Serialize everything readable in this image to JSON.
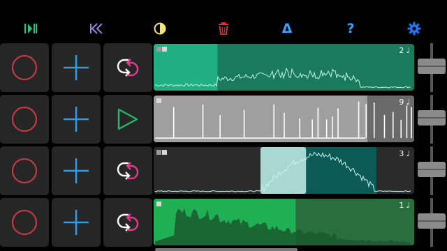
{
  "toolbar": {
    "buttons": [
      {
        "id": "play-pause",
        "icon": "play-pause-icon",
        "color": "#2ec27e"
      },
      {
        "id": "rewind",
        "icon": "rewind-icon",
        "color": "#9b7fe0"
      },
      {
        "id": "theme",
        "icon": "contrast-icon",
        "color": "#f5e27a"
      },
      {
        "id": "delete",
        "icon": "trash-icon",
        "color": "#e0303a"
      },
      {
        "id": "delta",
        "glyph": "Δ",
        "icon": "delta-icon",
        "color": "#3aa0ff"
      },
      {
        "id": "help",
        "glyph": "?",
        "icon": "help-icon",
        "color": "#3aa0ff"
      },
      {
        "id": "settings",
        "icon": "gear-icon",
        "color": "#1e78ff"
      }
    ]
  },
  "colors": {
    "record": "#c23a45",
    "add": "#2f9be8",
    "loop_arrow_white": "#ffffff",
    "loop_arrow_pink": "#e23a8f",
    "play": "#25b868",
    "control_bg": "#262626"
  },
  "tracks": [
    {
      "count_label": "2 ♩",
      "indicator": "double",
      "mode_icon": "loop-icon",
      "bg": "#1a7a5e",
      "active_fill": "#1faf82",
      "active_fraction": 0.245,
      "highlight": null,
      "wave_color": "#bff5e0",
      "wave_style": "line"
    },
    {
      "count_label": "9 ♩",
      "indicator": "single",
      "mode_icon": "play-icon",
      "bg": "#6a6a6a",
      "active_fill": "#9f9f9f",
      "active_fraction": 0.82,
      "highlight": null,
      "wave_color": "#ffffff",
      "wave_style": "spikes"
    },
    {
      "count_label": "3 ♩",
      "indicator": "double",
      "mode_icon": "loop-icon",
      "bg": "#2b2b2b",
      "active_fill": "#0c5a55",
      "active_fraction": null,
      "highlight": {
        "start": 0.41,
        "end": 0.585,
        "color": "#a9d7d2"
      },
      "region": {
        "start": 0.41,
        "end": 0.855
      },
      "wave_color": "#c8f2ef",
      "wave_style": "hump"
    },
    {
      "count_label": "1 ♩",
      "indicator": "single",
      "mode_icon": "loop-icon",
      "bg": "#2a6e3e",
      "active_fill": "#1fb054",
      "active_fraction": 0.545,
      "highlight": null,
      "wave_color": "#1a5a2e",
      "wave_style": "filled"
    }
  ]
}
